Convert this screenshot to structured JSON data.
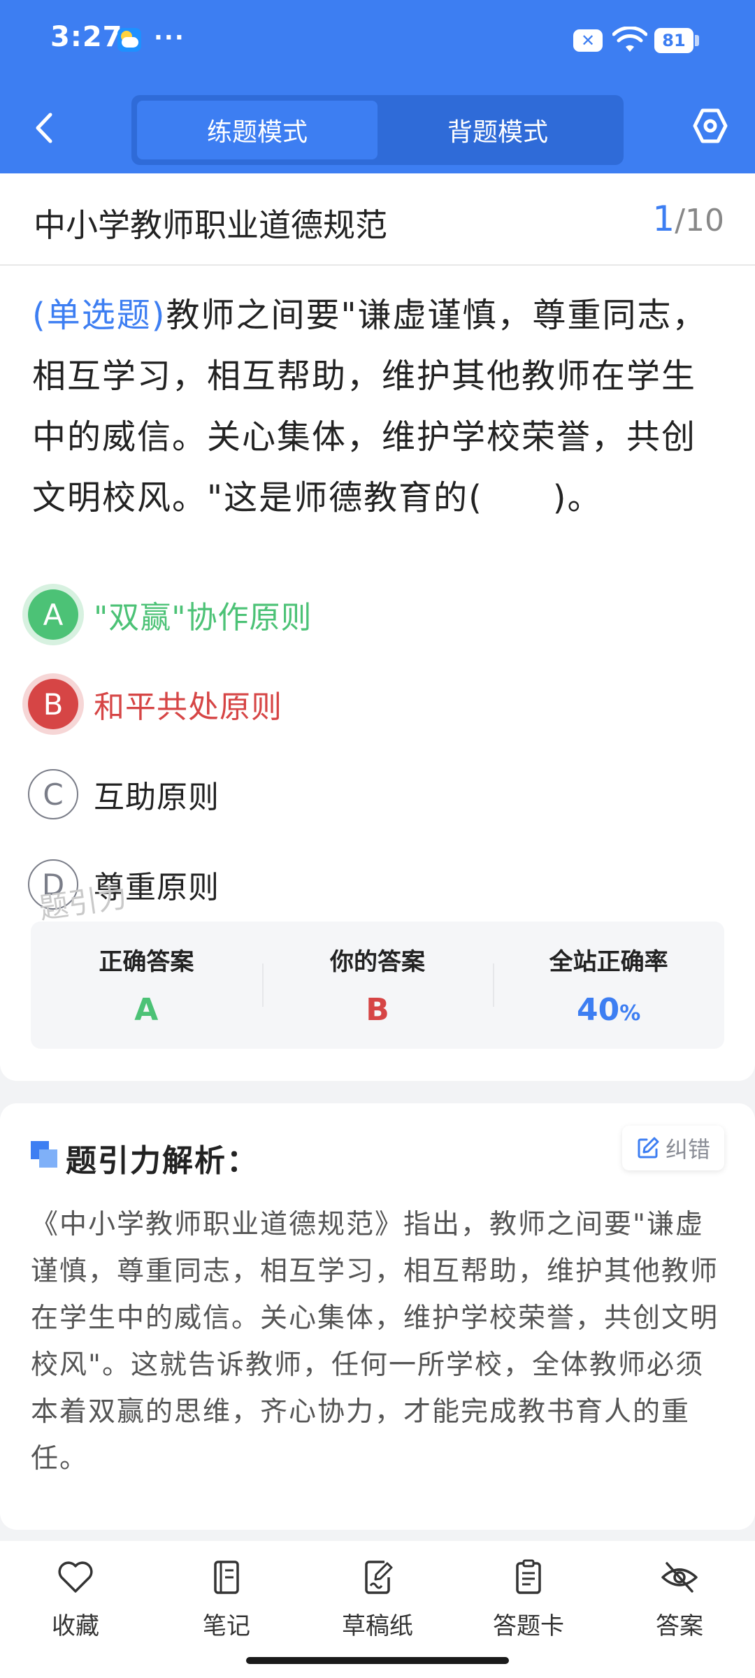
{
  "status_bar": {
    "time": "3:27",
    "more": "···",
    "battery": "81"
  },
  "header": {
    "tabs": [
      {
        "label": "练题模式",
        "active": true
      },
      {
        "label": "背题模式",
        "active": false
      }
    ],
    "accent_color": "#3d7ef2"
  },
  "subject": {
    "title": "中小学教师职业道德规范",
    "current": "1",
    "total": "/10"
  },
  "question": {
    "type": "(单选题)",
    "text": "教师之间要\"谦虚谨慎，尊重同志，相互学习，相互帮助，维护其他教师在学生中的威信。关心集体，维护学校荣誉，共创文明校风。\"这是师德教育的(　　)。"
  },
  "options": [
    {
      "letter": "A",
      "text": "\"双赢\"协作原则",
      "state": "correct"
    },
    {
      "letter": "B",
      "text": "和平共处原则",
      "state": "wrong"
    },
    {
      "letter": "C",
      "text": "互助原则",
      "state": "normal"
    },
    {
      "letter": "D",
      "text": "尊重原则",
      "state": "normal"
    }
  ],
  "watermark": "题引力",
  "answer_summary": {
    "correct_label": "正确答案",
    "correct_value": "A",
    "yours_label": "你的答案",
    "yours_value": "B",
    "rate_label": "全站正确率",
    "rate_value": "40",
    "rate_unit": "%"
  },
  "analysis": {
    "title": "题引力解析：",
    "report_label": "纠错",
    "body": "《中小学教师职业道德规范》指出，教师之间要\"谦虚谨慎，尊重同志，相互学习，相互帮助，维护其他教师在学生中的威信。关心集体，维护学校荣誉，共创文明校风\"。这就告诉教师，任何一所学校，全体教师必须本着双赢的思维，齐心协力，才能完成教书育人的重任。"
  },
  "bottom_nav": [
    {
      "label": "收藏",
      "icon": "heart-icon"
    },
    {
      "label": "笔记",
      "icon": "notebook-icon"
    },
    {
      "label": "草稿纸",
      "icon": "draft-icon"
    },
    {
      "label": "答题卡",
      "icon": "clipboard-icon"
    },
    {
      "label": "答案",
      "icon": "eye-off-icon"
    }
  ]
}
